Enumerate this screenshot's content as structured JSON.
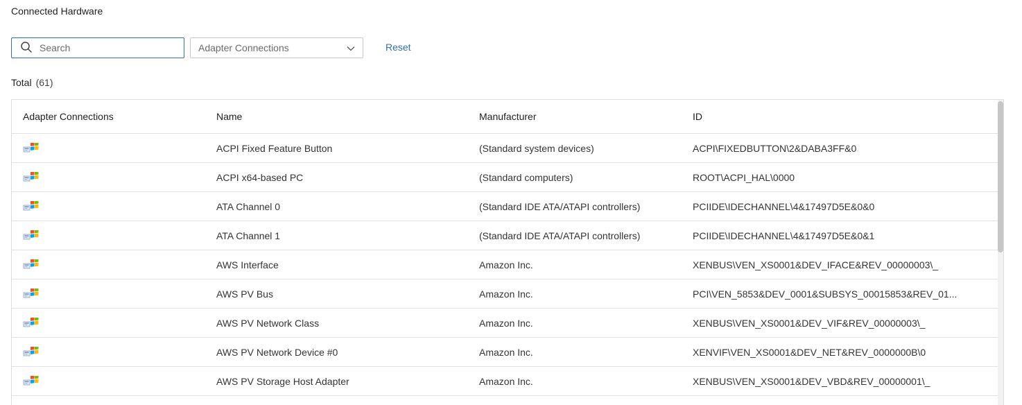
{
  "page": {
    "title": "Connected Hardware"
  },
  "filters": {
    "search_placeholder": "Search",
    "dropdown_value": "Adapter Connections",
    "reset_label": "Reset"
  },
  "summary": {
    "total_label": "Total",
    "total_count": "(61)"
  },
  "table": {
    "columns": [
      "Adapter Connections",
      "Name",
      "Manufacturer",
      "ID"
    ],
    "rows": [
      {
        "icon": "windows-hardware-icon",
        "name": "ACPI Fixed Feature Button",
        "manufacturer": "(Standard system devices)",
        "id": "ACPI\\FIXEDBUTTON\\2&DABA3FF&0"
      },
      {
        "icon": "windows-hardware-icon",
        "name": "ACPI x64-based PC",
        "manufacturer": "(Standard computers)",
        "id": "ROOT\\ACPI_HAL\\0000"
      },
      {
        "icon": "windows-hardware-icon",
        "name": "ATA Channel 0",
        "manufacturer": "(Standard IDE ATA/ATAPI controllers)",
        "id": "PCIIDE\\IDECHANNEL\\4&17497D5E&0&0"
      },
      {
        "icon": "windows-hardware-icon",
        "name": "ATA Channel 1",
        "manufacturer": "(Standard IDE ATA/ATAPI controllers)",
        "id": "PCIIDE\\IDECHANNEL\\4&17497D5E&0&1"
      },
      {
        "icon": "windows-hardware-icon",
        "name": "AWS Interface",
        "manufacturer": "Amazon Inc.",
        "id": "XENBUS\\VEN_XS0001&DEV_IFACE&REV_00000003\\_"
      },
      {
        "icon": "windows-hardware-icon",
        "name": "AWS PV Bus",
        "manufacturer": "Amazon Inc.",
        "id": "PCI\\VEN_5853&DEV_0001&SUBSYS_00015853&REV_01..."
      },
      {
        "icon": "windows-hardware-icon",
        "name": "AWS PV Network Class",
        "manufacturer": "Amazon Inc.",
        "id": "XENBUS\\VEN_XS0001&DEV_VIF&REV_00000003\\_"
      },
      {
        "icon": "windows-hardware-icon",
        "name": "AWS PV Network Device #0",
        "manufacturer": "Amazon Inc.",
        "id": "XENVIF\\VEN_XS0001&DEV_NET&REV_0000000B\\0"
      },
      {
        "icon": "windows-hardware-icon",
        "name": "AWS PV Storage Host Adapter",
        "manufacturer": "Amazon Inc.",
        "id": "XENBUS\\VEN_XS0001&DEV_VBD&REV_00000001\\_"
      },
      {
        "icon": "windows-hardware-icon",
        "name": "",
        "manufacturer": "",
        "id": ""
      }
    ]
  },
  "colors": {
    "accent": "#2f6fba",
    "border": "#dcdcdc",
    "row_divider": "#e3e3e3"
  }
}
